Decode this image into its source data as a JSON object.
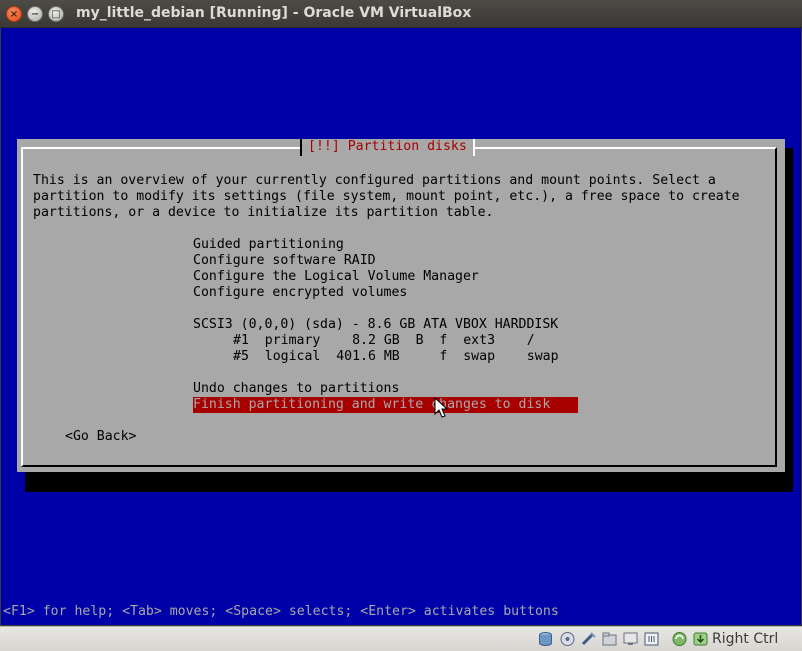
{
  "window": {
    "title": "my_little_debian [Running] - Oracle VM VirtualBox",
    "close_glyph": "×",
    "min_glyph": "−",
    "max_glyph": "□"
  },
  "installer": {
    "dialog_title": "[!!] Partition disks",
    "intro_lines": [
      "This is an overview of your currently configured partitions and mount points. Select a",
      "partition to modify its settings (file system, mount point, etc.), a free space to create",
      "partitions, or a device to initialize its partition table."
    ],
    "menu": [
      "Guided partitioning",
      "Configure software RAID",
      "Configure the Logical Volume Manager",
      "Configure encrypted volumes"
    ],
    "disk": {
      "header": "SCSI3 (0,0,0) (sda) - 8.6 GB ATA VBOX HARDDISK",
      "partitions": [
        "#1  primary    8.2 GB  B  f  ext3    /",
        "#5  logical  401.6 MB     f  swap    swap"
      ]
    },
    "undo": "Undo changes to partitions",
    "finish": "Finish partitioning and write changes to disk",
    "go_back": "<Go Back>"
  },
  "help_bar": "<F1> for help; <Tab> moves; <Space> selects; <Enter> activates buttons",
  "statusbar": {
    "icons": [
      "hard-disk-icon",
      "optical-drive-icon",
      "usb-icon",
      "shared-folders-icon",
      "display-icon",
      "network-icon",
      "mouse-integration-icon",
      "host-key-icon"
    ],
    "host_key": "Right Ctrl"
  }
}
